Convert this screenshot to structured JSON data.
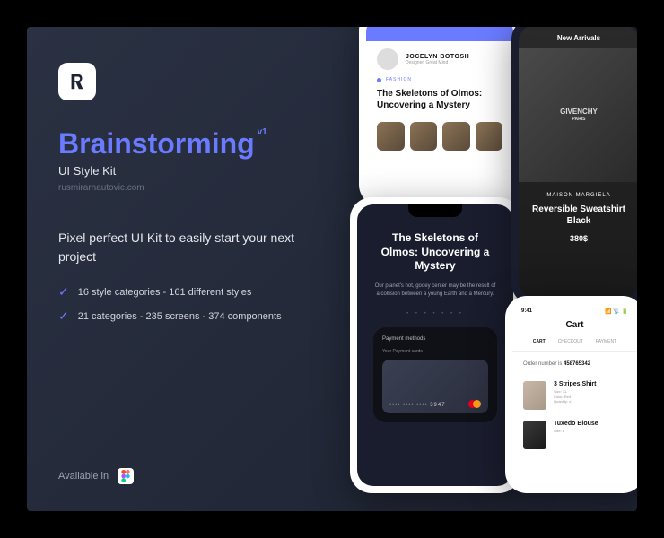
{
  "title": "Brainstorming",
  "version": "v1",
  "subtitle": "UI Style Kit",
  "url": "rusmirarnautovic.com",
  "tagline": "Pixel perfect UI Kit to easily start your next project",
  "features": [
    "16 style categories - 161 different styles",
    "21 categories - 235 screens - 374 components"
  ],
  "available": "Available in",
  "phone1": {
    "author": "JOCELYN BOTOSH",
    "authorDesc": "Designer, Great Mind",
    "category": "FASHION",
    "article": "The Skeletons of Olmos: Uncovering a Mystery"
  },
  "phone2": {
    "article": "The Skeletons of Olmos: Uncovering a Mystery",
    "sub": "Our planet's hot, gooey center may be the result of a collision between a young Earth and a Mercury.",
    "payment": "Payment methods",
    "yourCards": "Your Payment cards",
    "cardNum": "••••  ••••  ••••  3947"
  },
  "phone3": {
    "header": "New Arrivals",
    "logo1": "GIVENCHY",
    "logo2": "PARIS",
    "brand": "MAISON MARGIELA",
    "product": "Reversible Sweatshirt Black",
    "price": "380$"
  },
  "phone4": {
    "time": "9:41",
    "title": "Cart",
    "tabs": [
      "CART",
      "CHECKOUT",
      "PAYMENT"
    ],
    "orderLabel": "Order number is ",
    "orderNum": "458765342",
    "items": [
      {
        "name": "3 Stripes Shirt",
        "size": "Size: XL",
        "color": "Color: Red",
        "qty": "Quantity: x1"
      },
      {
        "name": "Tuxedo Blouse",
        "size": "Size: L"
      }
    ]
  }
}
